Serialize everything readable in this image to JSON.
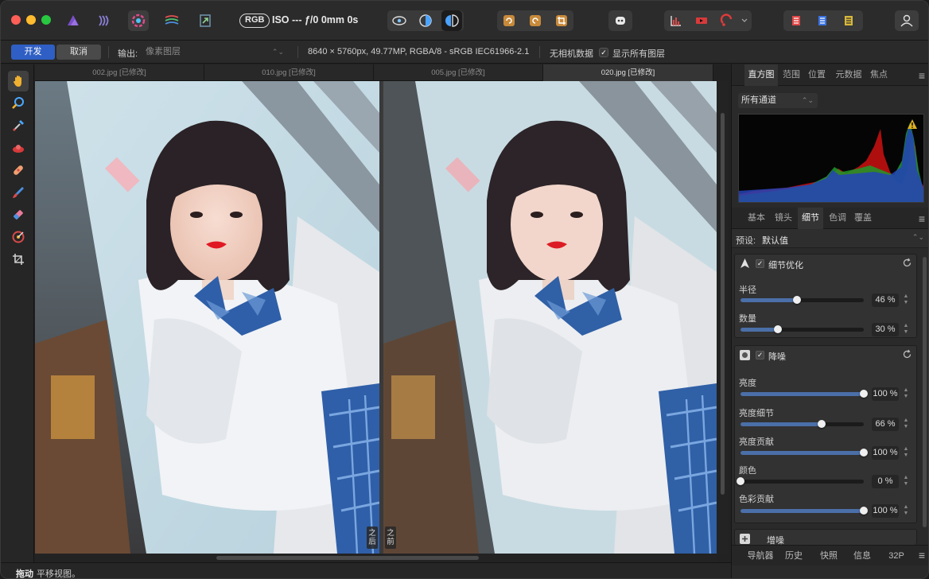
{
  "toolbar": {
    "rgb_pill": "RGB",
    "iso_text": "ISO --- ƒ/0 0mm 0s",
    "icons": [
      "designer-persona-icon",
      "liquify-persona-icon",
      "develop-persona-icon",
      "tone-mapping-persona-icon",
      "export-persona-icon",
      "view-original-icon",
      "split-view-icon",
      "mirror-view-icon",
      "rotate-left-icon",
      "rotate-right-icon",
      "crop-icon",
      "assistant-icon",
      "clipping-icon",
      "highlight-icon",
      "shadow-clip-icon",
      "color-icon",
      "color-adjust-icon",
      "user-icon"
    ]
  },
  "context": {
    "develop_label": "开发",
    "cancel_label": "取消",
    "output_label": "输出:",
    "output_value": "像素图层",
    "image_info": "8640 × 5760px, 49.77MP, RGBA/8 - sRGB IEC61966-2.1",
    "no_camera_data": "无相机数据",
    "show_all_layers": "显示所有图层",
    "checkmark": "✓"
  },
  "tools": [
    "view-tool-icon",
    "zoom-tool-icon",
    "white-balance-tool-icon",
    "red-eye-tool-icon",
    "blemish-tool-icon",
    "overlay-paint-tool-icon",
    "overlay-erase-tool-icon",
    "overlay-gradient-tool-icon",
    "crop-tool-icon"
  ],
  "tabs": [
    {
      "label": "002.jpg [已修改]"
    },
    {
      "label": "010.jpg [已修改]"
    },
    {
      "label": "005.jpg [已修改]"
    },
    {
      "label": "020.jpg [已修改]"
    }
  ],
  "split": {
    "after_label": "之后",
    "before_label": "之前"
  },
  "status": {
    "tool": "拖动",
    "hint": "平移视图。"
  },
  "panel_top_tabs": [
    "直方图",
    "范围",
    "位置",
    "元数据",
    "焦点"
  ],
  "histogram": {
    "channel": "所有通道",
    "warning_icon": "warning-icon"
  },
  "panel_mid_tabs": [
    "基本",
    "镜头",
    "细节",
    "色调",
    "覆盖"
  ],
  "preset": {
    "label": "预设:",
    "value": "默认值"
  },
  "detail_refinement": {
    "title": "细节优化",
    "sliders": [
      {
        "label": "半径",
        "value": "46 %",
        "pct": 46
      },
      {
        "label": "数量",
        "value": "30 %",
        "pct": 30
      }
    ]
  },
  "noise_reduction": {
    "title": "降噪",
    "sliders": [
      {
        "label": "亮度",
        "value": "100 %",
        "pct": 100
      },
      {
        "label": "亮度细节",
        "value": "66 %",
        "pct": 66
      },
      {
        "label": "亮度贡献",
        "value": "100 %",
        "pct": 100
      },
      {
        "label": "颜色",
        "value": "0 %",
        "pct": 0
      },
      {
        "label": "色彩贡献",
        "value": "100 %",
        "pct": 100
      }
    ]
  },
  "add_noise": {
    "title": "增噪"
  },
  "panel_bottom_tabs": [
    "导航器",
    "历史",
    "快照",
    "信息",
    "32P"
  ],
  "colors": {
    "accent": "#2f5fc4",
    "slider_fill": "#4b6fa8"
  }
}
